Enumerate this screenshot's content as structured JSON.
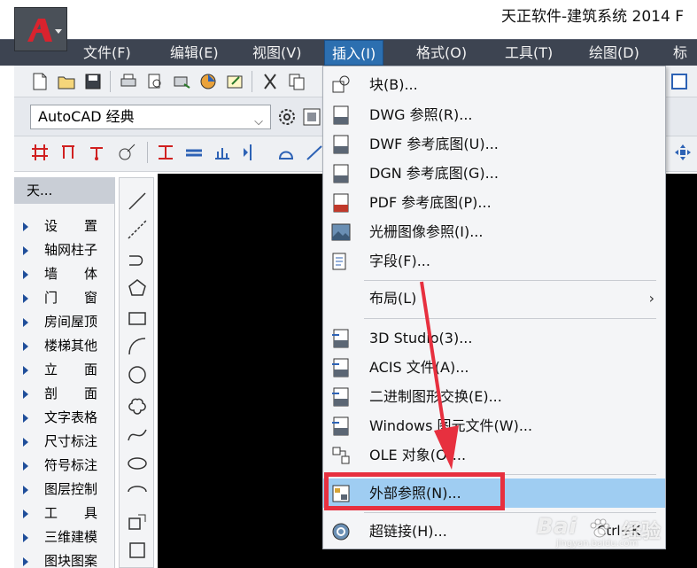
{
  "window": {
    "title": "天正软件-建筑系统 2014  F"
  },
  "menubar": {
    "items": [
      "文件(F)",
      "编辑(E)",
      "视图(V)",
      "插入(I)",
      "格式(O)",
      "工具(T)",
      "绘图(D)",
      "标"
    ],
    "active": "插入(I)"
  },
  "toolbar": {
    "workspace": "AutoCAD 经典",
    "workspace_arrow": "⌵"
  },
  "panel": {
    "header": "天...",
    "items": [
      "设　　置",
      "轴网柱子",
      "墙　　体",
      "门　　窗",
      "房间屋顶",
      "楼梯其他",
      "立　　面",
      "剖　　面",
      "文字表格",
      "尺寸标注",
      "符号标注",
      "图层控制",
      "工　　具",
      "三维建模",
      "图块图案"
    ]
  },
  "dropdown": {
    "items": [
      {
        "label": "块(B)...",
        "icon": "block-insert-icon"
      },
      {
        "label": "DWG 参照(R)...",
        "icon": "dwg-reference-icon"
      },
      {
        "label": "DWF 参考底图(U)...",
        "icon": "dwf-underlay-icon"
      },
      {
        "label": "DGN 参考底图(G)...",
        "icon": "dgn-underlay-icon"
      },
      {
        "label": "PDF 参考底图(P)...",
        "icon": "pdf-underlay-icon"
      },
      {
        "label": "光栅图像参照(I)...",
        "icon": "raster-image-icon"
      },
      {
        "label": "字段(F)...",
        "icon": "field-icon"
      },
      {
        "label": "布局(L)",
        "submenu": "›"
      },
      {
        "label": "3D Studio(3)...",
        "icon": "3ds-import-icon"
      },
      {
        "label": "ACIS 文件(A)...",
        "icon": "acis-import-icon"
      },
      {
        "label": "二进制图形交换(E)...",
        "icon": "dxb-import-icon"
      },
      {
        "label": "Windows 图元文件(W)...",
        "icon": "wmf-import-icon"
      },
      {
        "label": "OLE 对象(O)...",
        "icon": "ole-object-icon"
      },
      {
        "label": "外部参照(N)...",
        "icon": "xref-palette-icon"
      },
      {
        "label": "超链接(H)...",
        "icon": "hyperlink-icon",
        "shortcut": "Ctrl+K"
      }
    ]
  },
  "watermark": {
    "brand": "Bai",
    "suffix": "经验",
    "url": "jingyan.baidu.com"
  },
  "colors": {
    "menubar": "#3d4451",
    "menu_active": "#2c6fb0",
    "highlight_row": "#9fcdf2",
    "annotation_red": "#e7303f"
  }
}
